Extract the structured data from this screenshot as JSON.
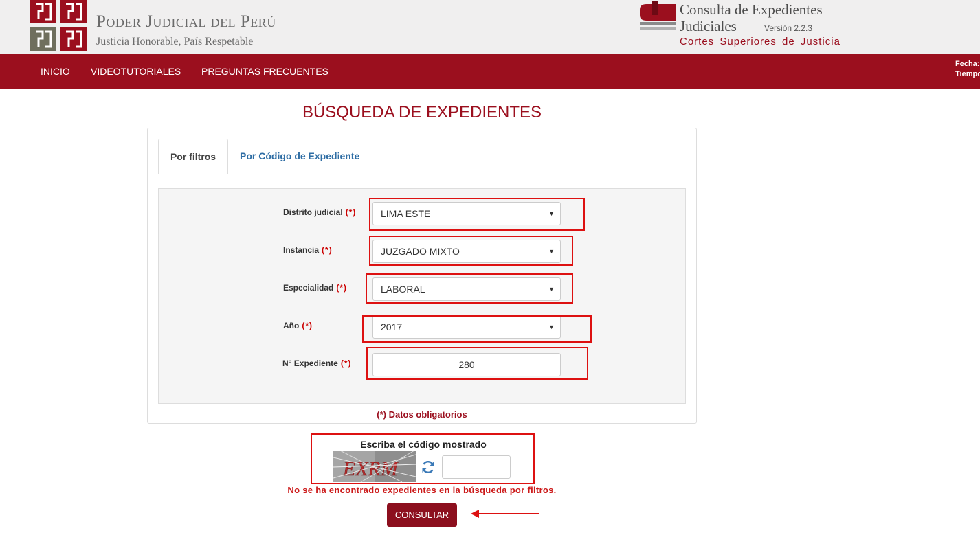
{
  "header": {
    "institution_title": "Poder Judicial del Perú",
    "institution_subtitle": "Justicia Honorable, País Respetable",
    "app_title_line1": "Consulta de Expedientes",
    "app_title_line2": "Judiciales",
    "version": "Versión 2.2.3",
    "cortes": "Cortes Superiores de Justicia"
  },
  "nav": {
    "items": [
      "INICIO",
      "VIDEOTUTORIALES",
      "PREGUNTAS FRECUENTES"
    ],
    "fecha_label": "Fecha:",
    "tiempo_label": "Tiempo"
  },
  "page": {
    "title": "BÚSQUEDA DE EXPEDIENTES"
  },
  "tabs": {
    "active": "Por filtros",
    "inactive": "Por Código de Expediente"
  },
  "form": {
    "required_marker": "(*)",
    "fields": [
      {
        "label": "Distrito judicial",
        "value": "LIMA ESTE"
      },
      {
        "label": "Instancia",
        "value": "JUZGADO MIXTO"
      },
      {
        "label": "Especialidad",
        "value": "LABORAL"
      },
      {
        "label": "Año",
        "value": "2017"
      },
      {
        "label": "N° Expediente",
        "value": "280"
      }
    ],
    "required_note": "(*) Datos obligatorios"
  },
  "captcha": {
    "title": "Escriba el código mostrado",
    "code": "EXRM",
    "input_value": ""
  },
  "error_message": "No se ha encontrado expedientes en la búsqueda por filtros.",
  "consult_button": "CONSULTAR",
  "colors": {
    "brand": "#9b0f1e",
    "highlight_box": "#dd1111",
    "tab_link": "#2e6da4"
  }
}
